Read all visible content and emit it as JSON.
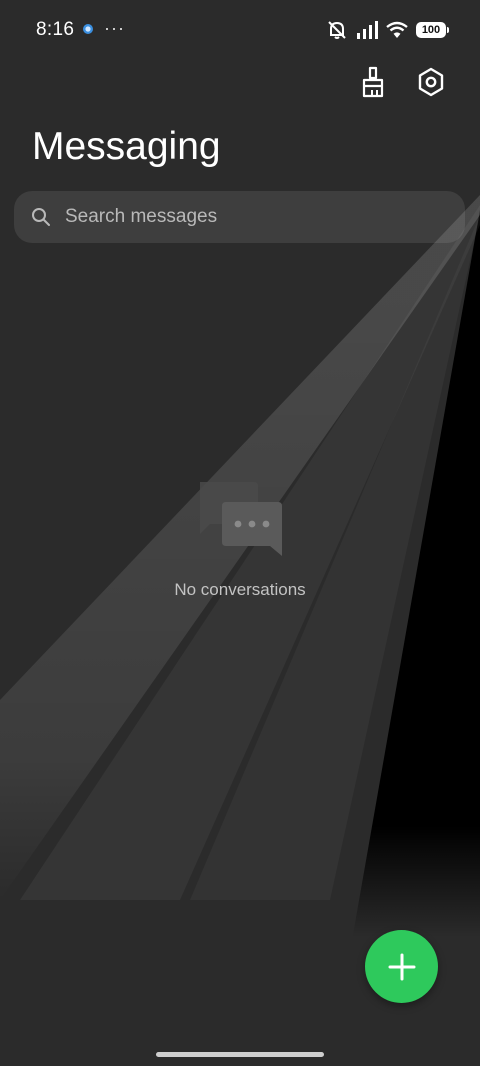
{
  "status_bar": {
    "time": "8:16",
    "more": "···",
    "battery": "100"
  },
  "header": {
    "title": "Messaging",
    "icons": [
      "broom-icon",
      "settings-icon"
    ]
  },
  "search": {
    "placeholder": "Search messages",
    "value": ""
  },
  "empty_state": {
    "text": "No conversations",
    "icon": "chat-bubbles-icon"
  },
  "fab": {
    "icon": "plus-icon",
    "color": "#2ec95c"
  },
  "colors": {
    "background": "#2b2b2b",
    "accent": "#2ec95c"
  }
}
